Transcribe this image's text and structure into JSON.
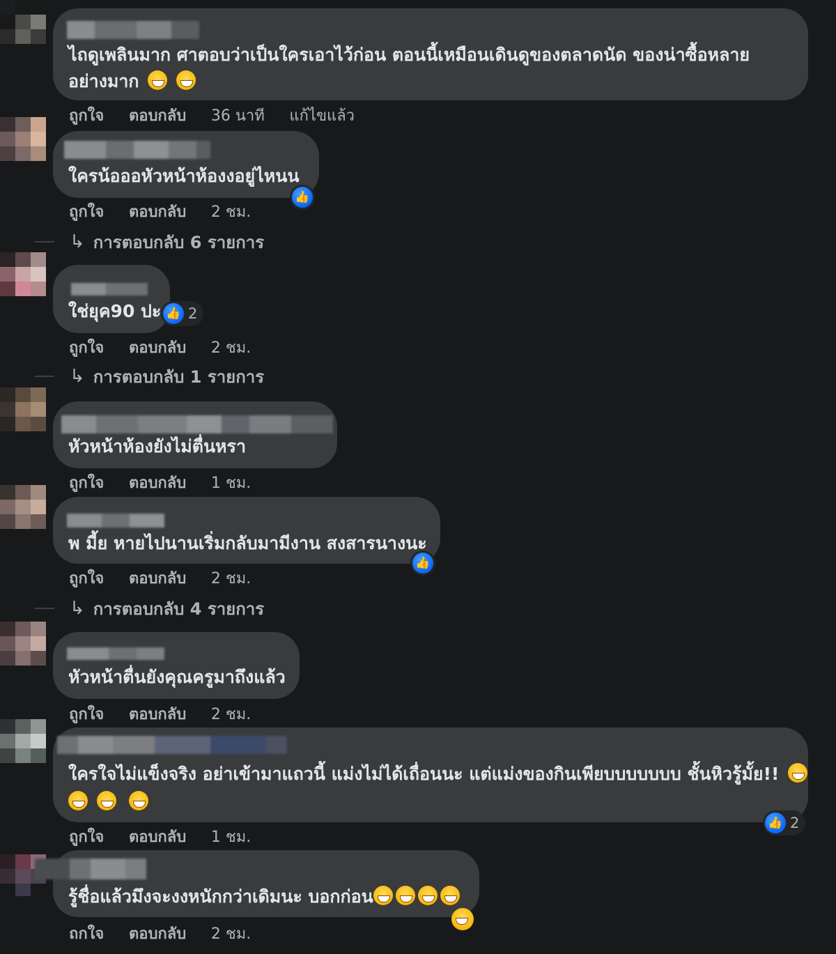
{
  "actions": {
    "like": "ถูกใจ",
    "reply": "ตอบกลับ",
    "like_alt": "ถกใจ"
  },
  "comments": [
    {
      "text_lines": [
        "ไถดูเพลินมาก ศาตอบว่าเป็นใครเอาไว้ก่อน ตอนนี้เหมือนเดินดูของตลาดนัด ของน่าซื้อหลาย",
        "อย่างมาก"
      ],
      "emojis": [
        "grinning-face-icon",
        "grinning-face-icon"
      ],
      "time": "36 นาที",
      "edited": "แก้ไขแล้ว"
    },
    {
      "text_lines": [
        "ใครน้อออหัวหน้าห้องงอยู่ไหนน"
      ],
      "time": "2 ชม.",
      "replies": "การตอบกลับ 6 รายการ"
    },
    {
      "text_lines": [
        "ใช่ยุค90 ปะ"
      ],
      "like_count": "2",
      "time": "2 ชม.",
      "replies": "การตอบกลับ 1 รายการ"
    },
    {
      "text_lines": [
        "หัวหน้าห้องยังไม่ตื่นหรา"
      ],
      "time": "1 ชม."
    },
    {
      "text_lines": [
        "พ มี้ย หายไปนานเริ่มกลับมามีงาน สงสารนางนะ"
      ],
      "time": "2 ชม.",
      "replies": "การตอบกลับ 4 รายการ"
    },
    {
      "text_lines": [
        "หัวหน้าตื่นยังคุณครูมาถึงแล้ว"
      ],
      "time": "2 ชม."
    },
    {
      "text_lines": [
        "ใครใจไม่แข็งจริง อย่าเข้ามาแถวนี้ แม่งไม่ได้เถื่อนนะ แต่แม่งของกินเพียบบบบบบบ ชั้นหิวรู้มั้ย!!",
        ""
      ],
      "like_count": "2",
      "time": "1 ชม."
    },
    {
      "text_lines": [
        "รู้ชื่อแล้วมึงจะงงหนักกว่าเดิมนะ บอกก่อน"
      ],
      "time": "2 ชม."
    }
  ],
  "colors": {
    "background": "#18191a",
    "bubble": "#3a3b3c",
    "text": "#e4e6eb",
    "secondary_text": "#b0b3b8",
    "like_blue": "#0866ff"
  }
}
